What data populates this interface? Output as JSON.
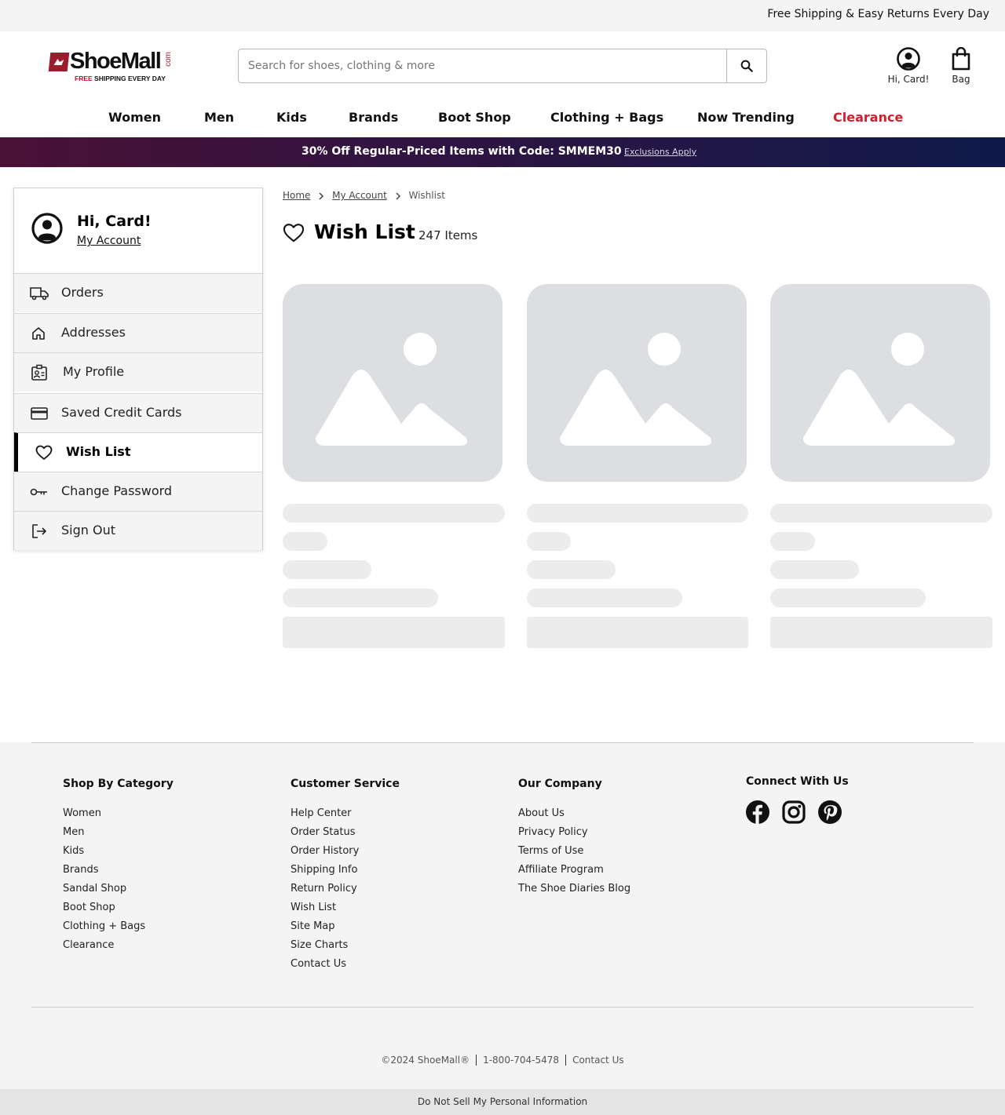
{
  "topbar": {
    "message": "Free Shipping & Easy Returns Every Day"
  },
  "logo": {
    "name": "ShoeMall",
    "suffix": "com",
    "tagline_red": "FREE",
    "tagline": " SHIPPING EVERY DAY"
  },
  "search": {
    "placeholder": "Search for shoes, clothing & more",
    "value": "",
    "icon": "search-icon"
  },
  "header": {
    "account_label": "Hi, Card!",
    "bag_label": "Bag"
  },
  "nav": {
    "items": [
      "Women",
      "Men",
      "Kids",
      "Brands",
      "Boot Shop",
      "Clothing + Bags",
      "Now Trending"
    ],
    "clearance": "Clearance",
    "clearance_color": "#d21f2e"
  },
  "promo": {
    "text": "30% Off Regular-Priced Items with Code: SMMEM30",
    "link": "Exclusions Apply"
  },
  "sidebar": {
    "greeting": "Hi, Card!",
    "account_link": "My Account",
    "items": [
      {
        "label": "Orders",
        "icon": "truck-icon"
      },
      {
        "label": "Addresses",
        "icon": "home-icon"
      },
      {
        "label": "My Profile",
        "icon": "id-badge-icon"
      },
      {
        "label": "Saved Credit Cards",
        "icon": "credit-card-icon"
      },
      {
        "label": "Wish List",
        "icon": "heart-icon",
        "active": true
      },
      {
        "label": "Change Password",
        "icon": "key-icon"
      },
      {
        "label": "Sign Out",
        "icon": "sign-out-icon"
      }
    ]
  },
  "breadcrumb": [
    "Home",
    "My Account",
    "Wishlist"
  ],
  "page": {
    "title": "Wish List",
    "count": "247 Items"
  },
  "products": {
    "loading": true,
    "placeholder_count": 3
  },
  "footer": {
    "shop": {
      "heading": "Shop By Category",
      "links": [
        "Women",
        "Men",
        "Kids",
        "Brands",
        "Sandal Shop",
        "Boot Shop",
        "Clothing + Bags",
        "Clearance"
      ]
    },
    "service": {
      "heading": "Customer Service",
      "links": [
        "Help Center",
        "Order Status",
        "Order History",
        "Shipping Info",
        "Return Policy",
        "Wish List",
        "Site Map",
        "Size Charts",
        "Contact Us"
      ]
    },
    "company": {
      "heading": "Our Company",
      "links": [
        "About Us",
        "Privacy Policy",
        "Terms of Use",
        "Affiliate Program",
        "The Shoe Diaries Blog"
      ]
    },
    "connect": {
      "heading": "Connect With Us",
      "icons": [
        "facebook-icon",
        "instagram-icon",
        "pinterest-icon"
      ]
    },
    "copyright": "©2024 ShoeMall®",
    "phone": "1-800-704-5478",
    "contact": "Contact Us",
    "do_not_sell": "Do Not Sell My Personal Information"
  },
  "colors": {
    "promo_start": "#4a1136",
    "promo_end": "#0f1a4a",
    "brand_red": "#9b1c2c",
    "placeholder_gray": "#dcdee2"
  }
}
